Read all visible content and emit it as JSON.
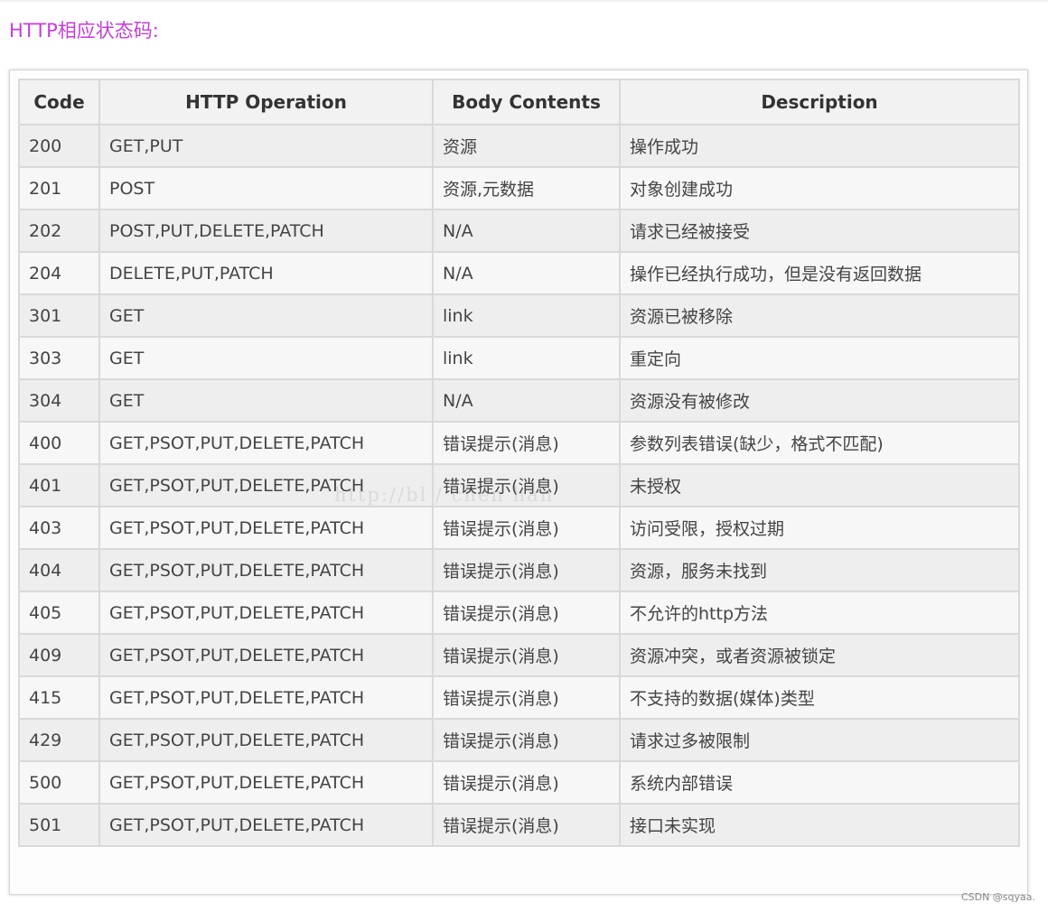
{
  "heading": "HTTP相应状态码:",
  "table": {
    "headers": [
      "Code",
      "HTTP Operation",
      "Body Contents",
      "Description"
    ],
    "rows": [
      [
        "200",
        "GET,PUT",
        "资源",
        "操作成功"
      ],
      [
        "201",
        "POST",
        "资源,元数据",
        "对象创建成功"
      ],
      [
        "202",
        "POST,PUT,DELETE,PATCH",
        "N/A",
        "请求已经被接受"
      ],
      [
        "204",
        "DELETE,PUT,PATCH",
        "N/A",
        "操作已经执行成功，但是没有返回数据"
      ],
      [
        "301",
        "GET",
        "link",
        "资源已被移除"
      ],
      [
        "303",
        "GET",
        "link",
        "重定向"
      ],
      [
        "304",
        "GET",
        "N/A",
        "资源没有被修改"
      ],
      [
        "400",
        "GET,PSOT,PUT,DELETE,PATCH",
        "错误提示(消息)",
        "参数列表错误(缺少，格式不匹配)"
      ],
      [
        "401",
        "GET,PSOT,PUT,DELETE,PATCH",
        "错误提示(消息)",
        "未授权"
      ],
      [
        "403",
        "GET,PSOT,PUT,DELETE,PATCH",
        "错误提示(消息)",
        "访问受限，授权过期"
      ],
      [
        "404",
        "GET,PSOT,PUT,DELETE,PATCH",
        "错误提示(消息)",
        "资源，服务未找到"
      ],
      [
        "405",
        "GET,PSOT,PUT,DELETE,PATCH",
        "错误提示(消息)",
        "不允许的http方法"
      ],
      [
        "409",
        "GET,PSOT,PUT,DELETE,PATCH",
        "错误提示(消息)",
        "资源冲突，或者资源被锁定"
      ],
      [
        "415",
        "GET,PSOT,PUT,DELETE,PATCH",
        "错误提示(消息)",
        "不支持的数据(媒体)类型"
      ],
      [
        "429",
        "GET,PSOT,PUT,DELETE,PATCH",
        "错误提示(消息)",
        "请求过多被限制"
      ],
      [
        "500",
        "GET,PSOT,PUT,DELETE,PATCH",
        "错误提示(消息)",
        "系统内部错误"
      ],
      [
        "501",
        "GET,PSOT,PUT,DELETE,PATCH",
        "错误提示(消息)",
        "接口未实现"
      ]
    ]
  },
  "watermark": "http://bl         /        chen         han",
  "credit": "CSDN @sqyaa."
}
